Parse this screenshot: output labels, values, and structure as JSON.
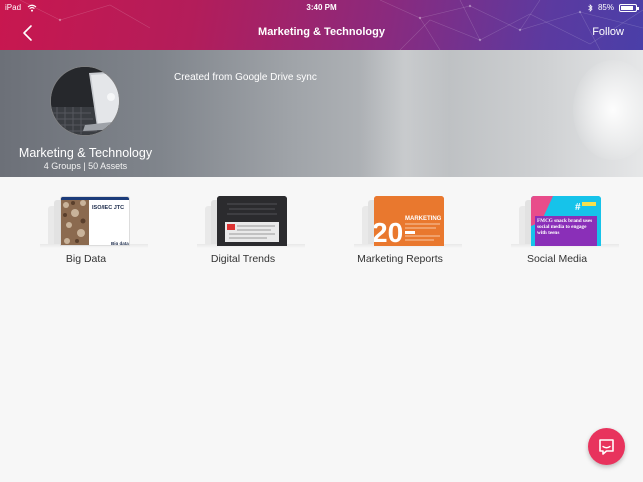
{
  "status_bar": {
    "device": "iPad",
    "time": "3:40 PM",
    "battery": "85%",
    "battery_level": 0.85
  },
  "nav": {
    "title": "Marketing & Technology",
    "follow_label": "Follow",
    "back_icon": "chevron-left-icon"
  },
  "hero": {
    "name": "Marketing & Technology",
    "stats": "4 Groups | 50 Assets",
    "description": "Created from Google Drive sync"
  },
  "groups": [
    {
      "label": "Big Data",
      "thumb_texts": [
        "ISO/IEC JTC",
        "Big data"
      ]
    },
    {
      "label": "Digital Trends"
    },
    {
      "label": "Marketing Reports",
      "thumb_texts": [
        "20",
        "MARKETING"
      ]
    },
    {
      "label": "Social Media",
      "thumb_texts": [
        "FMCG snack brand uses social media to engage with teens"
      ]
    }
  ],
  "fab": {
    "icon": "chat-icon"
  },
  "colors": {
    "header_start": "#c8174f",
    "header_end": "#4a3fa8",
    "fab": "#e8335d",
    "marketing_orange": "#e9782e",
    "social_cyan": "#16c3ea",
    "social_purple": "#8a2fb8"
  }
}
